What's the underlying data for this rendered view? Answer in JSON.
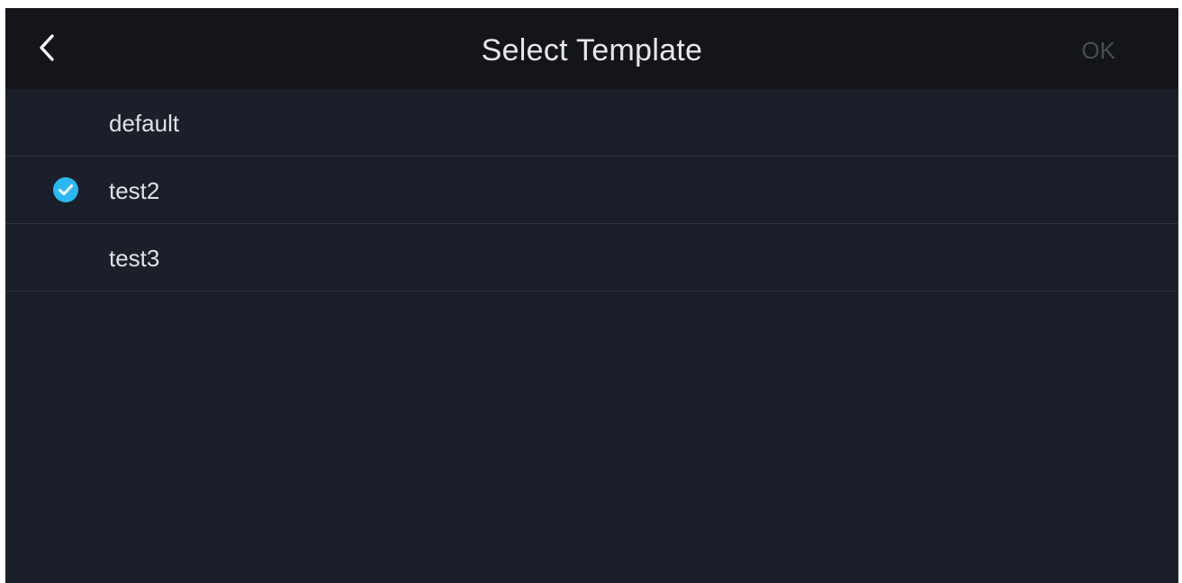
{
  "header": {
    "title": "Select Template",
    "back_icon": "chevron-left-icon",
    "ok_label": "OK"
  },
  "templates": [
    {
      "label": "default",
      "selected": false
    },
    {
      "label": "test2",
      "selected": true
    },
    {
      "label": "test3",
      "selected": false
    }
  ],
  "colors": {
    "background": "#1b1f29",
    "header_background": "#131519",
    "accent": "#2bb8f2",
    "ok_disabled": "#4a4d55"
  }
}
